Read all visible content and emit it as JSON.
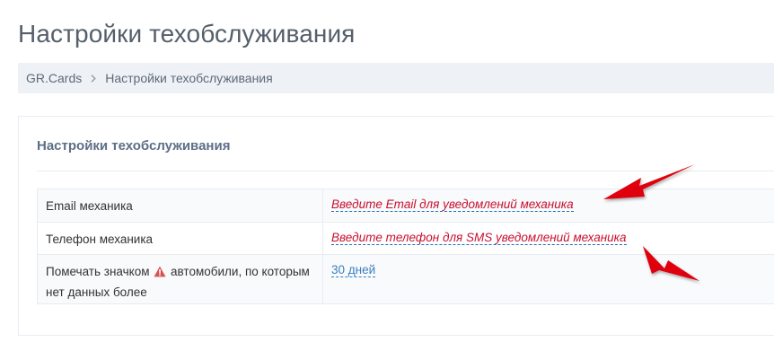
{
  "page": {
    "title": "Настройки техобслуживания"
  },
  "breadcrumb": {
    "items": [
      {
        "label": "GR.Cards"
      },
      {
        "label": "Настройки техобслуживания"
      }
    ],
    "separator_icon": "chevron-right-icon"
  },
  "portlet": {
    "title": "Настройки техобслуживания"
  },
  "settings": {
    "rows": [
      {
        "label": "Email механика",
        "value": "Введите Email для уведомлений механика",
        "state": "empty"
      },
      {
        "label": "Телефон механика",
        "value": "Введите телефон для SMS уведомлений механика",
        "state": "empty"
      },
      {
        "label_before_icon": "Помечать значком",
        "label_icon": "warning-icon",
        "label_after_icon": "автомобили, по которым нет данных более",
        "value": "30 дней",
        "state": "set"
      }
    ]
  },
  "colors": {
    "empty_value": "#c8102e",
    "set_value": "#3a7fc1",
    "annotation_arrow": "#e0000f",
    "warning_icon": "#d9534f",
    "breadcrumb_bg": "#eef1f5"
  },
  "annotations": {
    "arrows": [
      "arrow-to-email-field",
      "arrow-to-phone-field"
    ]
  }
}
